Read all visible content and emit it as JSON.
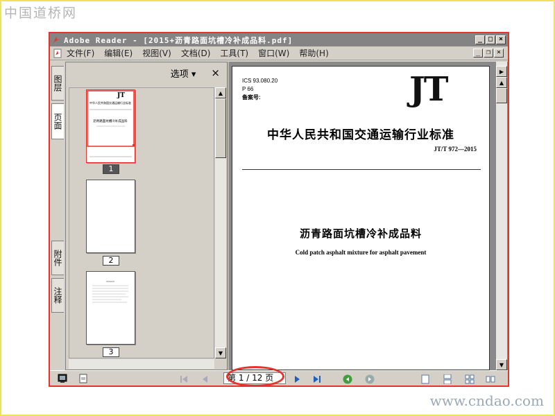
{
  "watermark": {
    "top": "中国道桥网",
    "bottom": "www.cndao.com"
  },
  "window": {
    "title": "Adobe Reader - [2015+沥青路面坑槽冷补成品料.pdf]"
  },
  "menu": [
    "文件(F)",
    "编辑(E)",
    "视图(V)",
    "文档(D)",
    "工具(T)",
    "窗口(W)",
    "帮助(H)"
  ],
  "side_tabs": [
    "图层",
    "页面",
    "附件",
    "注释"
  ],
  "panel": {
    "options_label": "选项",
    "close_label": "×"
  },
  "thumbnails": [
    {
      "page": "1",
      "selected": true
    },
    {
      "page": "2",
      "selected": false
    },
    {
      "page": "3",
      "selected": false
    }
  ],
  "thumb1": {
    "title": "中华人民共和国交通运输行业标准",
    "doc": "沥青路面坑槽冷补成品料"
  },
  "document": {
    "ics": "ICS 93.080.20",
    "p": "P 66",
    "record": "备案号:",
    "logo": "JT",
    "heading": "中华人民共和国交通运输行业标准",
    "code": "JT/T 972—2015",
    "title_cn": "沥青路面坑槽冷补成品料",
    "title_en": "Cold patch asphalt mixture for asphalt pavement"
  },
  "pager": {
    "label": "第 1 / 12 页",
    "current": 1,
    "total": 12
  },
  "colors": {
    "highlight": "#e8322c",
    "titlebar": "#848484",
    "chrome": "#d4d0c8",
    "nav_blue": "#1f5fbf",
    "nav_green": "#3f9f3f"
  }
}
